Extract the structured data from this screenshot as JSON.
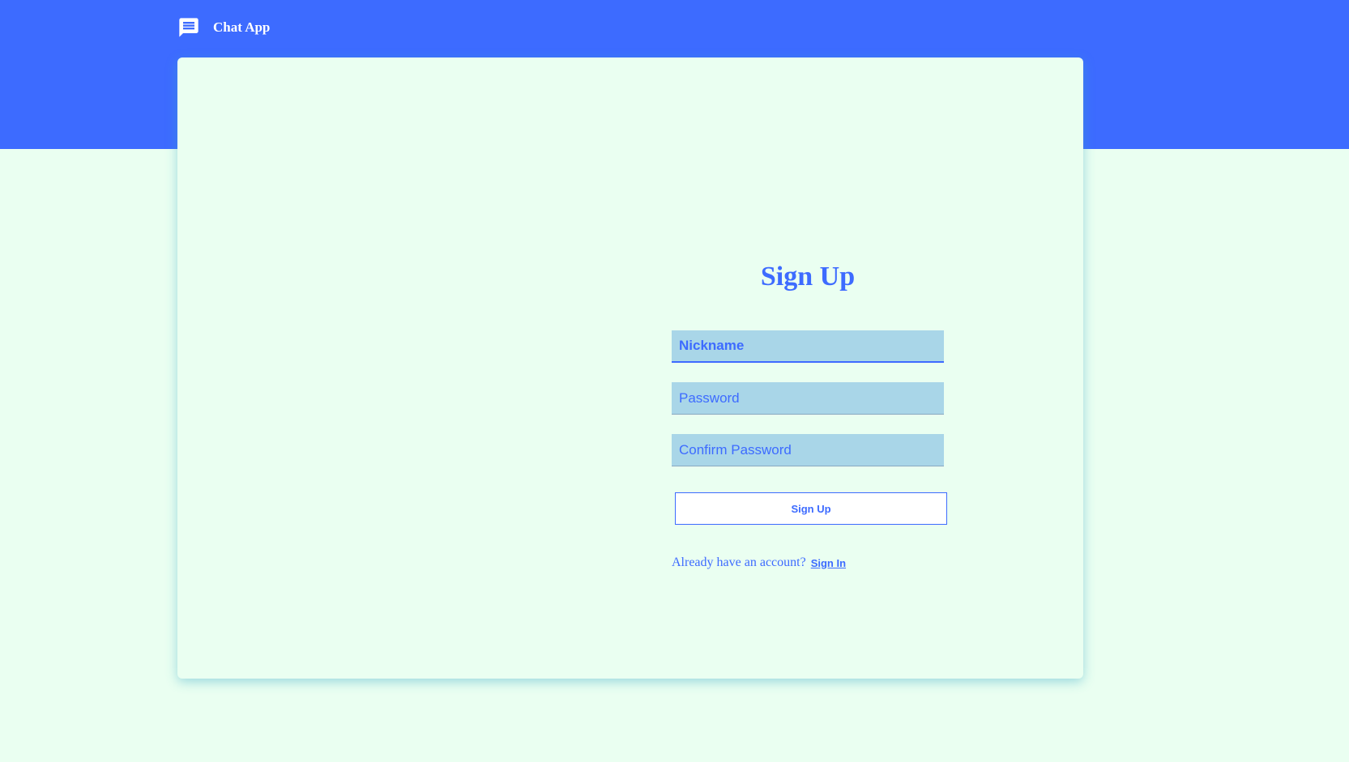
{
  "header": {
    "app_title": "Chat App",
    "icon": "chat-icon"
  },
  "form": {
    "title": "Sign Up",
    "fields": [
      {
        "placeholder": "Nickname",
        "value": "",
        "focused": true
      },
      {
        "placeholder": "Password",
        "value": ""
      },
      {
        "placeholder": "Confirm Password",
        "value": ""
      }
    ],
    "submit_label": "Sign Up",
    "signin_prompt": "Already have an account?",
    "signin_link": "Sign In"
  },
  "colors": {
    "accent": "#3d6bff",
    "background": "#eafff1",
    "field_background": "#a9d6e8"
  }
}
